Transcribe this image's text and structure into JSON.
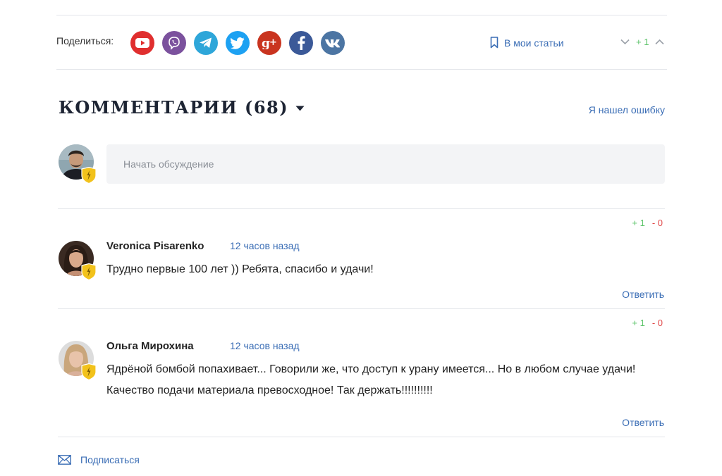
{
  "share": {
    "label": "Поделиться:",
    "networks": [
      {
        "name": "youtube",
        "color": "#e02f2f"
      },
      {
        "name": "viber",
        "color": "#7b519d"
      },
      {
        "name": "telegram",
        "color": "#2ea6d9"
      },
      {
        "name": "twitter",
        "color": "#1da1f2"
      },
      {
        "name": "google-plus",
        "color": "#c9341f"
      },
      {
        "name": "facebook",
        "color": "#3b5998"
      },
      {
        "name": "vk",
        "color": "#4c75a3"
      }
    ],
    "save_label": "В мои статьи",
    "rating": "+ 1"
  },
  "comments_section": {
    "title": "КОММЕНТАРИИ (68)",
    "report_link": "Я нашел ошибку",
    "new_comment_placeholder": "Начать обсуждение",
    "items": [
      {
        "author": "Veronica Pisarenko",
        "time": "12 часов назад",
        "text": "Трудно первые 100 лет )) Ребята, спасибо и удачи!",
        "plus": "+ 1",
        "minus": "- 0",
        "reply_label": "Ответить"
      },
      {
        "author": "Ольга Мирохина",
        "time": "12 часов назад",
        "text": "Ядрёной бомбой попахивает... Говорили же, что доступ к урану имеется... Но в любом случае удачи! Качество подачи материала превосходное! Так держать!!!!!!!!!!",
        "plus": "+ 1",
        "minus": "- 0",
        "reply_label": "Ответить"
      }
    ],
    "subscribe_label": "Подписаться"
  },
  "colors": {
    "accent": "#3a6db5",
    "positive": "#5ec46b",
    "negative": "#e04848",
    "badge": "#f2c21b"
  }
}
